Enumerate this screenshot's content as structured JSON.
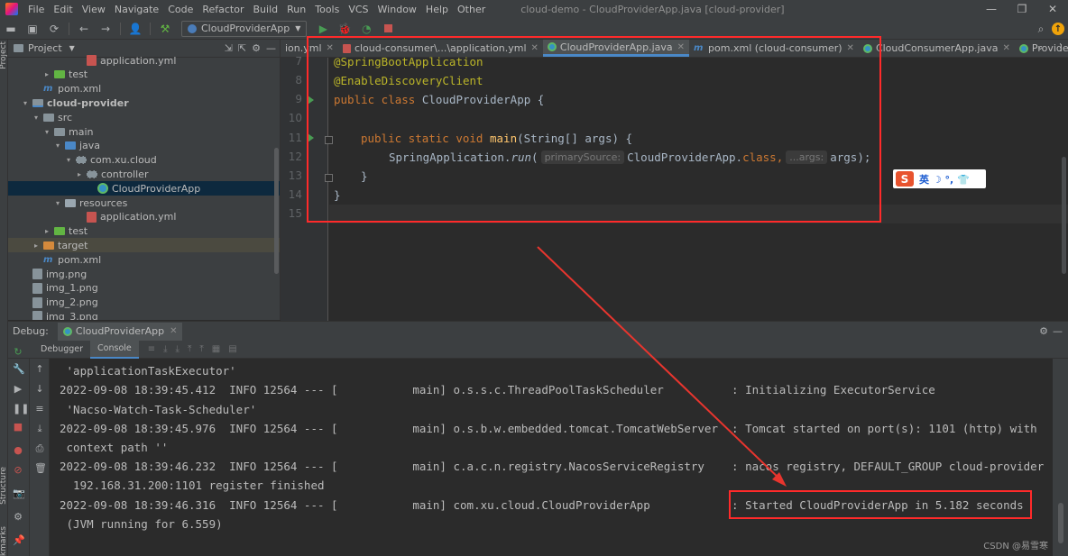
{
  "menubar": {
    "items": [
      "File",
      "Edit",
      "View",
      "Navigate",
      "Code",
      "Refactor",
      "Build",
      "Run",
      "Tools",
      "VCS",
      "Window",
      "Help",
      "Other"
    ],
    "title": "cloud-demo - CloudProviderApp.java [cloud-provider]"
  },
  "toolbar": {
    "run_config": "CloudProviderApp"
  },
  "project": {
    "header": "Project",
    "tree": [
      {
        "label": "application.yml",
        "depth": 6,
        "icon": "yml-file-icon",
        "arrow": ""
      },
      {
        "label": "test",
        "depth": 3,
        "icon": "test-folder-icon",
        "arrow": "▸"
      },
      {
        "label": "pom.xml",
        "depth": 2,
        "icon": "maven-icon",
        "arrow": ""
      },
      {
        "label": "cloud-provider",
        "depth": 1,
        "icon": "module-icon",
        "arrow": "▾",
        "bold": true
      },
      {
        "label": "src",
        "depth": 2,
        "icon": "folder-icon",
        "arrow": "▾"
      },
      {
        "label": "main",
        "depth": 3,
        "icon": "folder-icon",
        "arrow": "▾"
      },
      {
        "label": "java",
        "depth": 4,
        "icon": "source-folder-icon",
        "arrow": "▾"
      },
      {
        "label": "com.xu.cloud",
        "depth": 5,
        "icon": "package-icon",
        "arrow": "▾"
      },
      {
        "label": "controller",
        "depth": 6,
        "icon": "package-icon",
        "arrow": "▸"
      },
      {
        "label": "CloudProviderApp",
        "depth": 7,
        "icon": "class-icon",
        "arrow": "",
        "selected": true
      },
      {
        "label": "resources",
        "depth": 4,
        "icon": "resources-folder-icon",
        "arrow": "▾"
      },
      {
        "label": "application.yml",
        "depth": 6,
        "icon": "yml-file-icon",
        "arrow": ""
      },
      {
        "label": "test",
        "depth": 3,
        "icon": "test-folder-icon",
        "arrow": "▸"
      },
      {
        "label": "target",
        "depth": 2,
        "icon": "target-folder-icon",
        "arrow": "▸",
        "excluded": true
      },
      {
        "label": "pom.xml",
        "depth": 2,
        "icon": "maven-icon",
        "arrow": ""
      },
      {
        "label": "img.png",
        "depth": 1,
        "icon": "image-file-icon",
        "arrow": ""
      },
      {
        "label": "img_1.png",
        "depth": 1,
        "icon": "image-file-icon",
        "arrow": ""
      },
      {
        "label": "img_2.png",
        "depth": 1,
        "icon": "image-file-icon",
        "arrow": ""
      },
      {
        "label": "img_3.png",
        "depth": 1,
        "icon": "image-file-icon",
        "arrow": ""
      }
    ]
  },
  "editor_tabs": [
    {
      "label": "ion.yml",
      "icon": "yml-file-icon",
      "active": false
    },
    {
      "label": "cloud-consumer\\...\\application.yml",
      "icon": "yml-file-icon",
      "active": false
    },
    {
      "label": "CloudProviderApp.java",
      "icon": "class-icon",
      "active": true
    },
    {
      "label": "pom.xml (cloud-consumer)",
      "icon": "maven-icon",
      "active": false
    },
    {
      "label": "CloudConsumerApp.java",
      "icon": "class-icon",
      "active": false
    },
    {
      "label": "ProviderController.j",
      "icon": "class-icon",
      "active": false
    }
  ],
  "code": {
    "line_numbers": [
      "7",
      "8",
      "9",
      "10",
      "11",
      "12",
      "13",
      "14",
      "15"
    ],
    "l7": "@SpringBootApplication",
    "l8": "@EnableDiscoveryClient",
    "l9_kw": "public class ",
    "l9_name": "CloudProviderApp {",
    "l11_kw": "public static void ",
    "l11_fn": "main",
    "l11_rest": "(String[] args) {",
    "l12_a": "SpringApplication.",
    "l12_run": "run",
    "l12_b": "(",
    "l12_hint1": "primarySource:",
    "l12_c": "CloudProviderApp.",
    "l12_class": "class",
    "l12_d": ",",
    "l12_hint2": "...args:",
    "l12_e": "args);",
    "l13": "}",
    "l14": "}"
  },
  "ime": {
    "logo": "S",
    "text": "英 ☽ °, 👕"
  },
  "debug": {
    "title": "Debug:",
    "tab": "CloudProviderApp",
    "subtabs": [
      "Debugger",
      "Console"
    ]
  },
  "console_lines": [
    " 'applicationTaskExecutor'",
    "2022-09-08 18:39:45.412  INFO 12564 --- [           main] o.s.s.c.ThreadPoolTaskScheduler          : Initializing ExecutorService",
    " 'Nacso-Watch-Task-Scheduler'",
    "2022-09-08 18:39:45.976  INFO 12564 --- [           main] o.s.b.w.embedded.tomcat.TomcatWebServer  : Tomcat started on port(s): 1101 (http) with",
    " context path ''",
    "2022-09-08 18:39:46.232  INFO 12564 --- [           main] c.a.c.n.registry.NacosServiceRegistry    : nacos registry, DEFAULT_GROUP cloud-provider",
    "  192.168.31.200:1101 register finished",
    "2022-09-08 18:39:46.316  INFO 12564 --- [           main] com.xu.cloud.CloudProviderApp            : Started CloudProviderApp in 5.182 seconds",
    " (JVM running for 6.559)"
  ],
  "stripe_labels": {
    "project": "Project",
    "structure": "Structure",
    "bookmarks": "Bookmarks"
  },
  "watermark": "CSDN @易雪寒",
  "colors": {
    "annotation_box": "#ff2a2a",
    "arrow": "#e8352e",
    "accent": "#4a88c7"
  }
}
